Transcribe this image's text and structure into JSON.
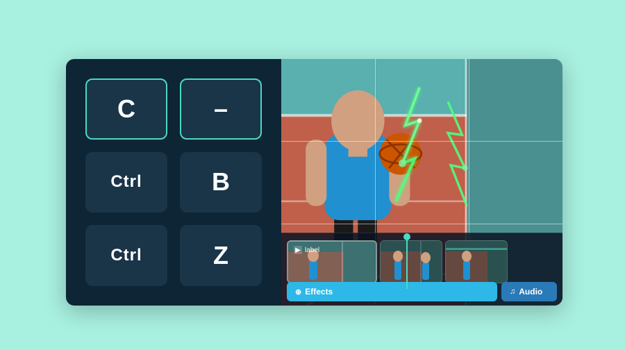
{
  "background_color": "#a8f0e0",
  "keyboard_panel": {
    "keys": [
      {
        "id": "key-c",
        "label": "C",
        "highlighted": true,
        "style": "large"
      },
      {
        "id": "key-minus",
        "label": "–",
        "highlighted": true,
        "style": "large"
      },
      {
        "id": "key-ctrl-1",
        "label": "Ctrl",
        "highlighted": false,
        "style": "ctrl"
      },
      {
        "id": "key-b",
        "label": "B",
        "highlighted": false,
        "style": "large"
      },
      {
        "id": "key-ctrl-2",
        "label": "Ctrl",
        "highlighted": false,
        "style": "ctrl"
      },
      {
        "id": "key-z",
        "label": "Z",
        "highlighted": false,
        "style": "large"
      }
    ]
  },
  "video_panel": {
    "has_lightning_effect": true
  },
  "timeline": {
    "clips": [
      {
        "id": "clip-main",
        "label": "label",
        "type": "main"
      },
      {
        "id": "clip-sec-1",
        "label": "",
        "type": "secondary"
      },
      {
        "id": "clip-sec-2",
        "label": "",
        "type": "secondary"
      }
    ]
  },
  "tabs": [
    {
      "id": "tab-effects",
      "label": "Effects",
      "icon": "⊕",
      "active": true
    },
    {
      "id": "tab-audio",
      "label": "Audio",
      "icon": "♫",
      "active": false
    }
  ]
}
